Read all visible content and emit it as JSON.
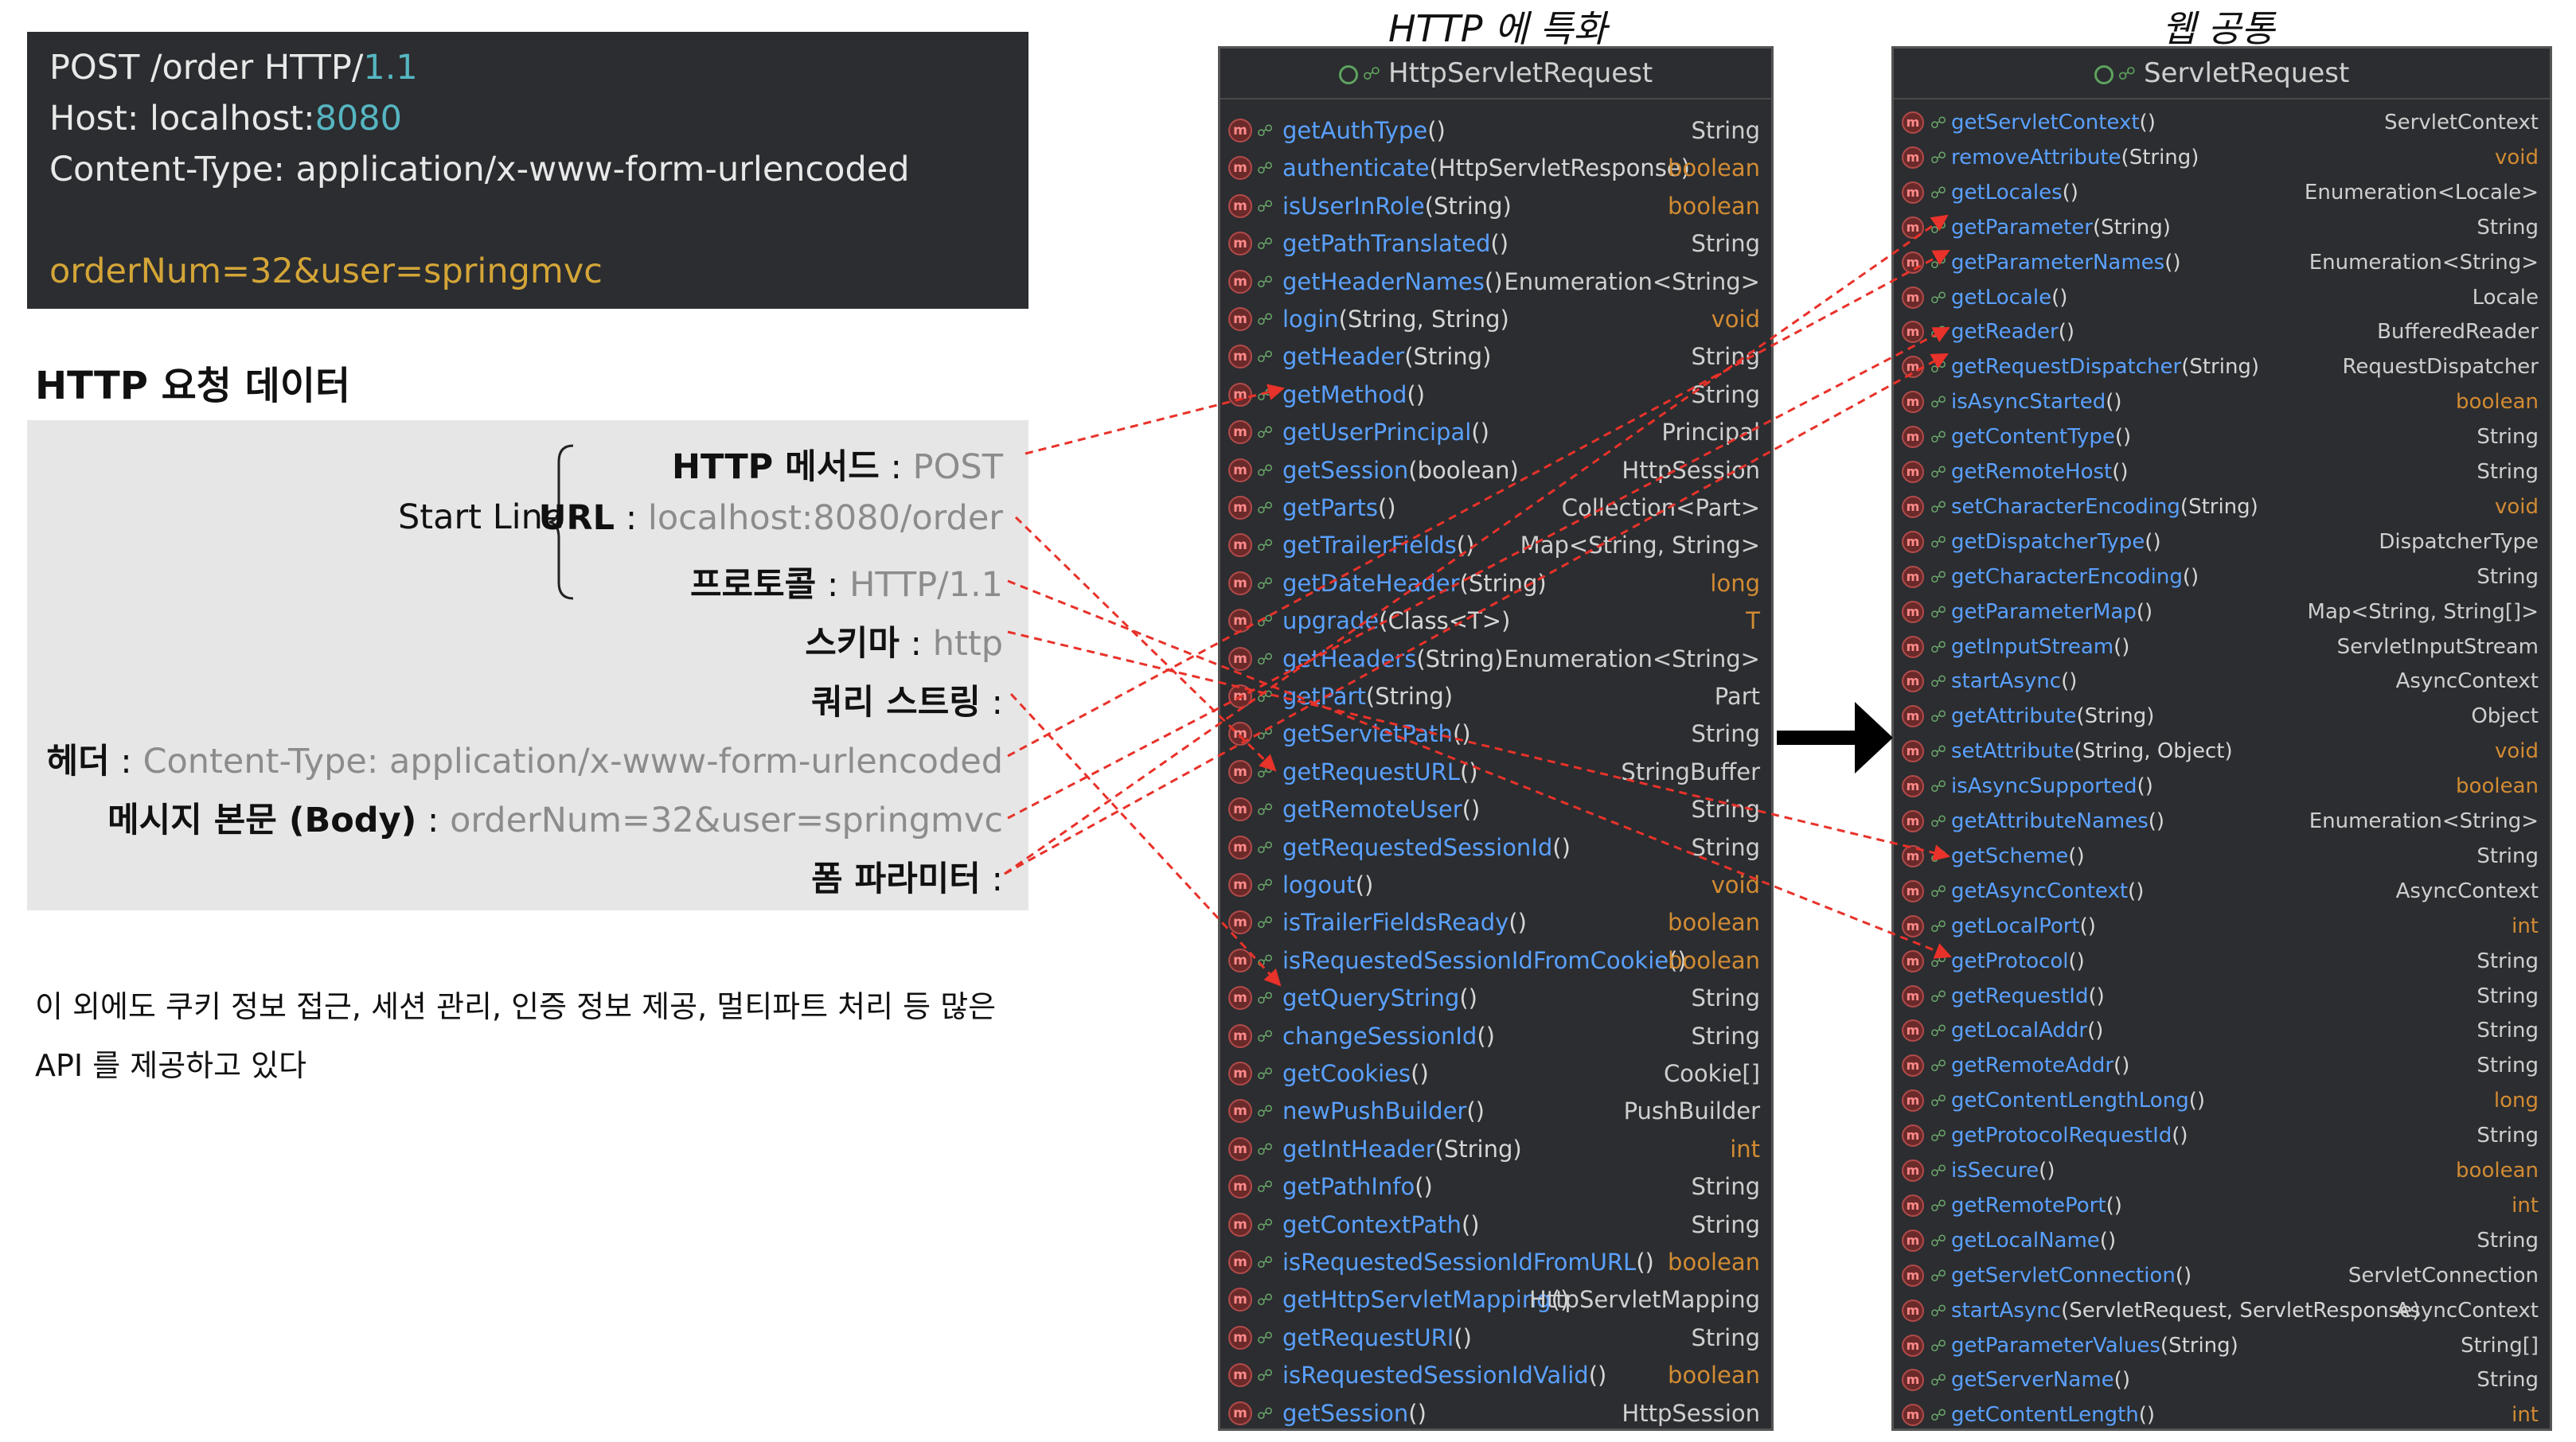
{
  "http_message": {
    "line1_prefix": "POST /order HTTP/",
    "line1_version": "1.1",
    "line2_prefix": "Host: localhost:",
    "line2_port": "8080",
    "line3": "Content-Type: application/x-www-form-urlencoded",
    "body": "orderNum=32&user=springmvc"
  },
  "section_title": "HTTP 요청 데이터",
  "start_line_label": "Start Line",
  "request_items": [
    {
      "key": "HTTP 메서드",
      "sep": " : ",
      "value": "POST"
    },
    {
      "key": "URL",
      "sep": " : ",
      "value": "localhost:8080/order"
    },
    {
      "key": "프로토콜",
      "sep": " : ",
      "value": "HTTP/1.1"
    },
    {
      "key": "스키마",
      "sep": " : ",
      "value": "http"
    },
    {
      "key": "쿼리 스트링",
      "sep": " :",
      "value": ""
    },
    {
      "key": "헤더",
      "sep": " : ",
      "value": "Content-Type: application/x-www-form-urlencoded"
    },
    {
      "key": "메시지 본문 (Body)",
      "sep": " : ",
      "value": "orderNum=32&user=springmvc"
    },
    {
      "key": "폼 파라미터",
      "sep": " :",
      "value": ""
    }
  ],
  "note": "이 외에도 쿠키 정보 접근, 세션 관리, 인증 정보 제공, 멀티파트 처리 등 많은 API 를 제공하고 있다",
  "panels": {
    "http": {
      "heading": "HTTP 에 특화",
      "title": "HttpServletRequest",
      "methods": [
        {
          "name": "getAuthType",
          "params": "()",
          "ret": "String"
        },
        {
          "name": "authenticate",
          "params": "(HttpServletResponse)",
          "ret": "boolean"
        },
        {
          "name": "isUserInRole",
          "params": "(String)",
          "ret": "boolean"
        },
        {
          "name": "getPathTranslated",
          "params": "()",
          "ret": "String"
        },
        {
          "name": "getHeaderNames",
          "params": "()",
          "ret": "Enumeration<String>"
        },
        {
          "name": "login",
          "params": "(String, String)",
          "ret": "void"
        },
        {
          "name": "getHeader",
          "params": "(String)",
          "ret": "String"
        },
        {
          "name": "getMethod",
          "params": "()",
          "ret": "String"
        },
        {
          "name": "getUserPrincipal",
          "params": "()",
          "ret": "Principal"
        },
        {
          "name": "getSession",
          "params": "(boolean)",
          "ret": "HttpSession"
        },
        {
          "name": "getParts",
          "params": "()",
          "ret": "Collection<Part>"
        },
        {
          "name": "getTrailerFields",
          "params": "()",
          "ret": "Map<String, String>"
        },
        {
          "name": "getDateHeader",
          "params": "(String)",
          "ret": "long"
        },
        {
          "name": "upgrade",
          "params": "(Class<T>)",
          "ret": "T"
        },
        {
          "name": "getHeaders",
          "params": "(String)",
          "ret": "Enumeration<String>"
        },
        {
          "name": "getPart",
          "params": "(String)",
          "ret": "Part"
        },
        {
          "name": "getServletPath",
          "params": "()",
          "ret": "String"
        },
        {
          "name": "getRequestURL",
          "params": "()",
          "ret": "StringBuffer"
        },
        {
          "name": "getRemoteUser",
          "params": "()",
          "ret": "String"
        },
        {
          "name": "getRequestedSessionId",
          "params": "()",
          "ret": "String"
        },
        {
          "name": "logout",
          "params": "()",
          "ret": "void"
        },
        {
          "name": "isTrailerFieldsReady",
          "params": "()",
          "ret": "boolean"
        },
        {
          "name": "isRequestedSessionIdFromCookie",
          "params": "()",
          "ret": "boolean"
        },
        {
          "name": "getQueryString",
          "params": "()",
          "ret": "String"
        },
        {
          "name": "changeSessionId",
          "params": "()",
          "ret": "String"
        },
        {
          "name": "getCookies",
          "params": "()",
          "ret": "Cookie[]"
        },
        {
          "name": "newPushBuilder",
          "params": "()",
          "ret": "PushBuilder"
        },
        {
          "name": "getIntHeader",
          "params": "(String)",
          "ret": "int"
        },
        {
          "name": "getPathInfo",
          "params": "()",
          "ret": "String"
        },
        {
          "name": "getContextPath",
          "params": "()",
          "ret": "String"
        },
        {
          "name": "isRequestedSessionIdFromURL",
          "params": "()",
          "ret": "boolean"
        },
        {
          "name": "getHttpServletMapping",
          "params": "()",
          "ret": "HttpServletMapping"
        },
        {
          "name": "getRequestURI",
          "params": "()",
          "ret": "String"
        },
        {
          "name": "isRequestedSessionIdValid",
          "params": "()",
          "ret": "boolean"
        },
        {
          "name": "getSession",
          "params": "()",
          "ret": "HttpSession"
        }
      ]
    },
    "web": {
      "heading": "웹 공통",
      "title": "ServletRequest",
      "methods": [
        {
          "name": "getServletContext",
          "params": "()",
          "ret": "ServletContext"
        },
        {
          "name": "removeAttribute",
          "params": "(String)",
          "ret": "void"
        },
        {
          "name": "getLocales",
          "params": "()",
          "ret": "Enumeration<Locale>"
        },
        {
          "name": "getParameter",
          "params": "(String)",
          "ret": "String"
        },
        {
          "name": "getParameterNames",
          "params": "()",
          "ret": "Enumeration<String>"
        },
        {
          "name": "getLocale",
          "params": "()",
          "ret": "Locale"
        },
        {
          "name": "getReader",
          "params": "()",
          "ret": "BufferedReader"
        },
        {
          "name": "getRequestDispatcher",
          "params": "(String)",
          "ret": "RequestDispatcher"
        },
        {
          "name": "isAsyncStarted",
          "params": "()",
          "ret": "boolean"
        },
        {
          "name": "getContentType",
          "params": "()",
          "ret": "String"
        },
        {
          "name": "getRemoteHost",
          "params": "()",
          "ret": "String"
        },
        {
          "name": "setCharacterEncoding",
          "params": "(String)",
          "ret": "void"
        },
        {
          "name": "getDispatcherType",
          "params": "()",
          "ret": "DispatcherType"
        },
        {
          "name": "getCharacterEncoding",
          "params": "()",
          "ret": "String"
        },
        {
          "name": "getParameterMap",
          "params": "()",
          "ret": "Map<String, String[]>"
        },
        {
          "name": "getInputStream",
          "params": "()",
          "ret": "ServletInputStream"
        },
        {
          "name": "startAsync",
          "params": "()",
          "ret": "AsyncContext"
        },
        {
          "name": "getAttribute",
          "params": "(String)",
          "ret": "Object"
        },
        {
          "name": "setAttribute",
          "params": "(String, Object)",
          "ret": "void"
        },
        {
          "name": "isAsyncSupported",
          "params": "()",
          "ret": "boolean"
        },
        {
          "name": "getAttributeNames",
          "params": "()",
          "ret": "Enumeration<String>"
        },
        {
          "name": "getScheme",
          "params": "()",
          "ret": "String"
        },
        {
          "name": "getAsyncContext",
          "params": "()",
          "ret": "AsyncContext"
        },
        {
          "name": "getLocalPort",
          "params": "()",
          "ret": "int"
        },
        {
          "name": "getProtocol",
          "params": "()",
          "ret": "String"
        },
        {
          "name": "getRequestId",
          "params": "()",
          "ret": "String"
        },
        {
          "name": "getLocalAddr",
          "params": "()",
          "ret": "String"
        },
        {
          "name": "getRemoteAddr",
          "params": "()",
          "ret": "String"
        },
        {
          "name": "getContentLengthLong",
          "params": "()",
          "ret": "long"
        },
        {
          "name": "getProtocolRequestId",
          "params": "()",
          "ret": "String"
        },
        {
          "name": "isSecure",
          "params": "()",
          "ret": "boolean"
        },
        {
          "name": "getRemotePort",
          "params": "()",
          "ret": "int"
        },
        {
          "name": "getLocalName",
          "params": "()",
          "ret": "String"
        },
        {
          "name": "getServletConnection",
          "params": "()",
          "ret": "ServletConnection"
        },
        {
          "name": "startAsync",
          "params": "(ServletRequest, ServletResponse)",
          "ret": "AsyncContext"
        },
        {
          "name": "getParameterValues",
          "params": "(String)",
          "ret": "String[]"
        },
        {
          "name": "getServerName",
          "params": "()",
          "ret": "String"
        },
        {
          "name": "getContentLength",
          "params": "()",
          "ret": "int"
        }
      ]
    }
  },
  "colors": {
    "arrow": "#e8322a",
    "method_name": "#5aa0ff",
    "keyword": "#d28b33",
    "panel_bg": "#2b2d30"
  },
  "icons": [
    "method-icon",
    "lock-icon",
    "class-icon",
    "right-arrow-icon",
    "brace-icon"
  ]
}
